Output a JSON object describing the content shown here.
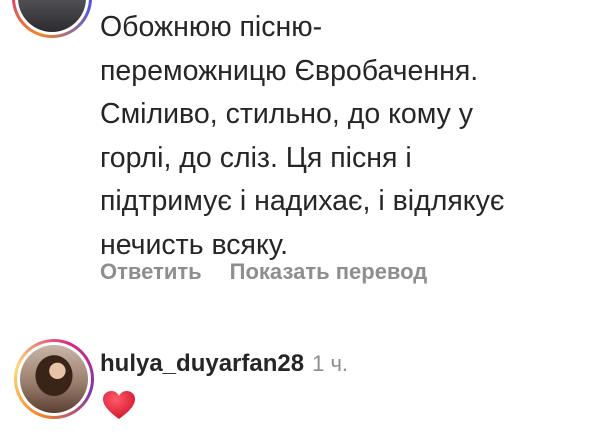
{
  "comment1": {
    "text": "Обожнюю пісню-\nпереможницю Євробачення.\nСміливо, стильно, до кому у\nгорлі, до сліз. Ця пісня і\nпідтримує і надихає, і відлякує\nнечисть всяку.",
    "actions": {
      "reply_label": "Ответить",
      "translate_label": "Показать перевод"
    }
  },
  "comment2": {
    "username": "hulya_duyarfan28",
    "time": "1 ч.",
    "reaction_icon": "red-heart-emoji"
  },
  "colors": {
    "text": "#262626",
    "secondary": "#8e8e8e",
    "heart": "#e0263a"
  }
}
